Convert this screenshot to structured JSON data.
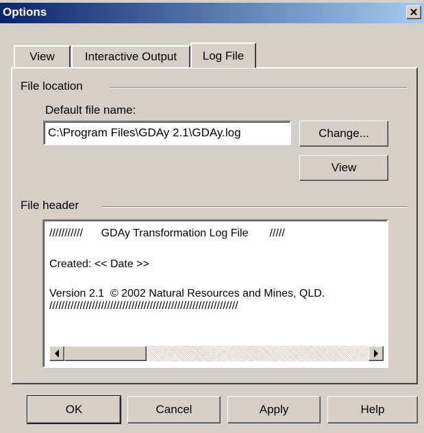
{
  "window": {
    "title": "Options"
  },
  "tabs": [
    {
      "label": "View"
    },
    {
      "label": "Interactive Output"
    },
    {
      "label": "Log File"
    }
  ],
  "file_location": {
    "group_label": "File location",
    "default_file_name_label": "Default file name:",
    "default_file_name_value": "C:\\Program Files\\GDAy 2.1\\GDAy.log",
    "change_button": "Change...",
    "view_button": "View"
  },
  "file_header": {
    "group_label": "File header",
    "lines": [
      "///////////      GDAy Transformation Log File       /////",
      "",
      "Created: << Date >>",
      "",
      "Version 2.1  © 2002 Natural Resources and Mines, QLD.",
      "//////////////////////////////////////////////////////////////"
    ]
  },
  "buttons": {
    "ok": "OK",
    "cancel": "Cancel",
    "apply": "Apply",
    "help": "Help"
  },
  "icons": {
    "close": "close-icon",
    "scroll_left": "scroll-left-arrow-icon",
    "scroll_right": "scroll-right-arrow-icon"
  }
}
